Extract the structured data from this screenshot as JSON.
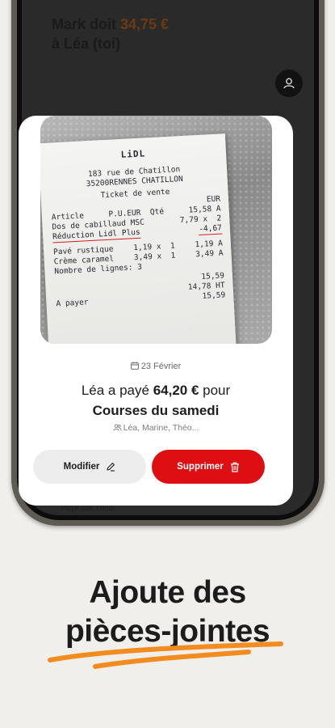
{
  "background": {
    "title_prefix": "Mark doit ",
    "title_amount": "34,75 €",
    "title_line2": "à Léa (toi)",
    "footer_text": "Payé par Théo"
  },
  "modal": {
    "receipt": {
      "logo": "LiDL",
      "address_line1": "183 rue de Chatillon",
      "address_line2": "35200RENNES CHATILLON",
      "ticket_label": "Ticket de vente",
      "col_eur": "EUR",
      "col_headers_left": "Article",
      "col_headers_mid": "P.U.EUR  Qté",
      "col_headers_right": "15,58 A",
      "item1_name": "Dos de cabillaud MSC",
      "item1_detail": "7,79 x  2",
      "item1_discount": "-4,67",
      "discount_label": "Réduction Lidl Plus",
      "item2_name": "Pavé rustique",
      "item2_detail": "1,19 x  1",
      "item2_price": "1,19 A",
      "item3_name": "Crème caramel",
      "item3_detail": "3,49 x  1",
      "item3_price": "3,49 A",
      "lines_count": "Nombre de lignes: 3",
      "subtotal": "15,59",
      "ht": "14,78 HT",
      "to_pay_label": "A payer",
      "to_pay_value": "15,59"
    },
    "date": "23 Février",
    "paid_prefix": "Léa a payé ",
    "paid_amount": "64,20 €",
    "paid_suffix": " pour",
    "expense_title": "Courses du samedi",
    "participants": "Léa, Marine, Théo...",
    "edit_label": "Modifier",
    "delete_label": "Supprimer"
  },
  "headline": {
    "line1": "Ajoute des",
    "line2": "pièces-jointes"
  },
  "colors": {
    "accent_red": "#de0f12",
    "highlight_orange": "#f28c1f",
    "background": "#f1efeb"
  },
  "icons": {
    "calendar": "calendar-icon",
    "participants": "people-icon",
    "edit": "pencil-icon",
    "delete": "trash-icon",
    "avatar": "user-avatar-icon"
  }
}
